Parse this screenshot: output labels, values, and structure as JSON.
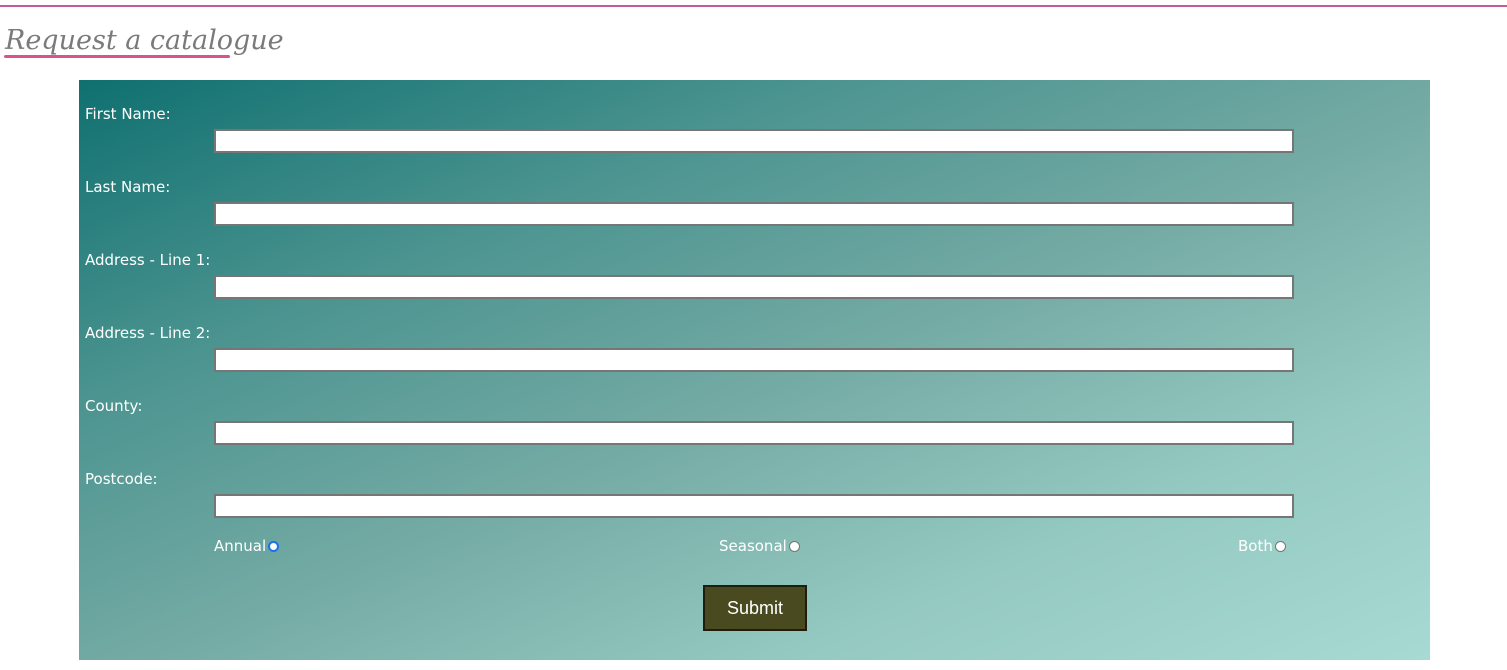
{
  "heading": {
    "title": "Request a catalogue"
  },
  "form": {
    "fields": [
      {
        "label": "First Name:",
        "value": ""
      },
      {
        "label": "Last Name:",
        "value": ""
      },
      {
        "label": "Address - Line 1:",
        "value": ""
      },
      {
        "label": "Address - Line 2:",
        "value": ""
      },
      {
        "label": "County:",
        "value": ""
      },
      {
        "label": "Postcode:",
        "value": ""
      }
    ],
    "catalogue_options": [
      {
        "label": "Annual",
        "selected": true
      },
      {
        "label": "Seasonal",
        "selected": false
      },
      {
        "label": "Both",
        "selected": false
      }
    ],
    "submit_label": "Submit"
  },
  "colors": {
    "accent_rule": "#c75b9a",
    "heading_underline": "#d9538f",
    "panel_gradient_start": "#0f7070",
    "panel_gradient_end": "#a6dad3",
    "submit_background": "#494a1f",
    "radio_selected": "#1a73e8"
  }
}
